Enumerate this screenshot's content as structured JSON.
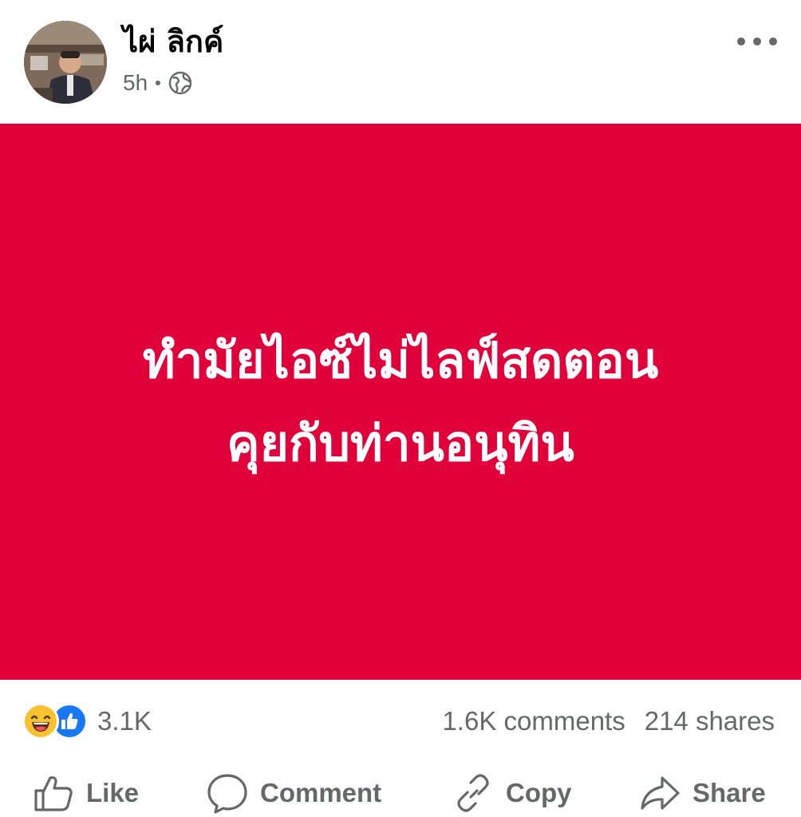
{
  "post": {
    "author_name": "ไผ่ ลิกค์",
    "timestamp": "5h",
    "audience_icon": "globe-icon",
    "menu_icon": "more-horizontal-icon"
  },
  "banner": {
    "background_color": "#e0003a",
    "text_color": "#ffffff",
    "line1": "ทำมัยไอซ์ไม่ไลฟ์สดตอน",
    "line2": "คุยกับท่านอนุทิน"
  },
  "stats": {
    "reaction_icons": [
      "haha-icon",
      "like-icon"
    ],
    "reaction_count": "3.1K",
    "comments": "1.6K comments",
    "shares": "214 shares"
  },
  "actions": {
    "like": {
      "label": "Like",
      "icon": "thumbs-up-icon"
    },
    "comment": {
      "label": "Comment",
      "icon": "speech-bubble-icon"
    },
    "copy": {
      "label": "Copy",
      "icon": "link-icon"
    },
    "share": {
      "label": "Share",
      "icon": "share-arrow-icon"
    }
  },
  "colors": {
    "primary_text": "#050505",
    "secondary_text": "#65676b",
    "like_blue": "#1877f2",
    "haha_yellow": "#f7c12f"
  }
}
